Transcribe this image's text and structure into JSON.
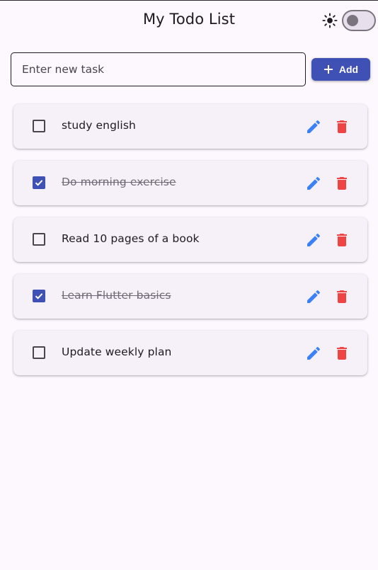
{
  "app_bar": {
    "title": "My Todo List",
    "theme_icon": "sun-icon",
    "dark_mode_enabled": false
  },
  "new_task": {
    "placeholder": "Enter new task",
    "value": "",
    "add_label": "Add",
    "add_icon": "plus-icon"
  },
  "colors": {
    "primary": "#3f51b5",
    "edit_icon": "#3b82f6",
    "delete_icon": "#ef4444",
    "background": "#fdf7fe",
    "card": "#f6f1f8"
  },
  "tasks": [
    {
      "text": "study english",
      "done": false
    },
    {
      "text": "Do morning exercise",
      "done": true
    },
    {
      "text": "Read 10 pages of a book",
      "done": false
    },
    {
      "text": "Learn Flutter basics",
      "done": true
    },
    {
      "text": "Update weekly plan",
      "done": false
    }
  ]
}
